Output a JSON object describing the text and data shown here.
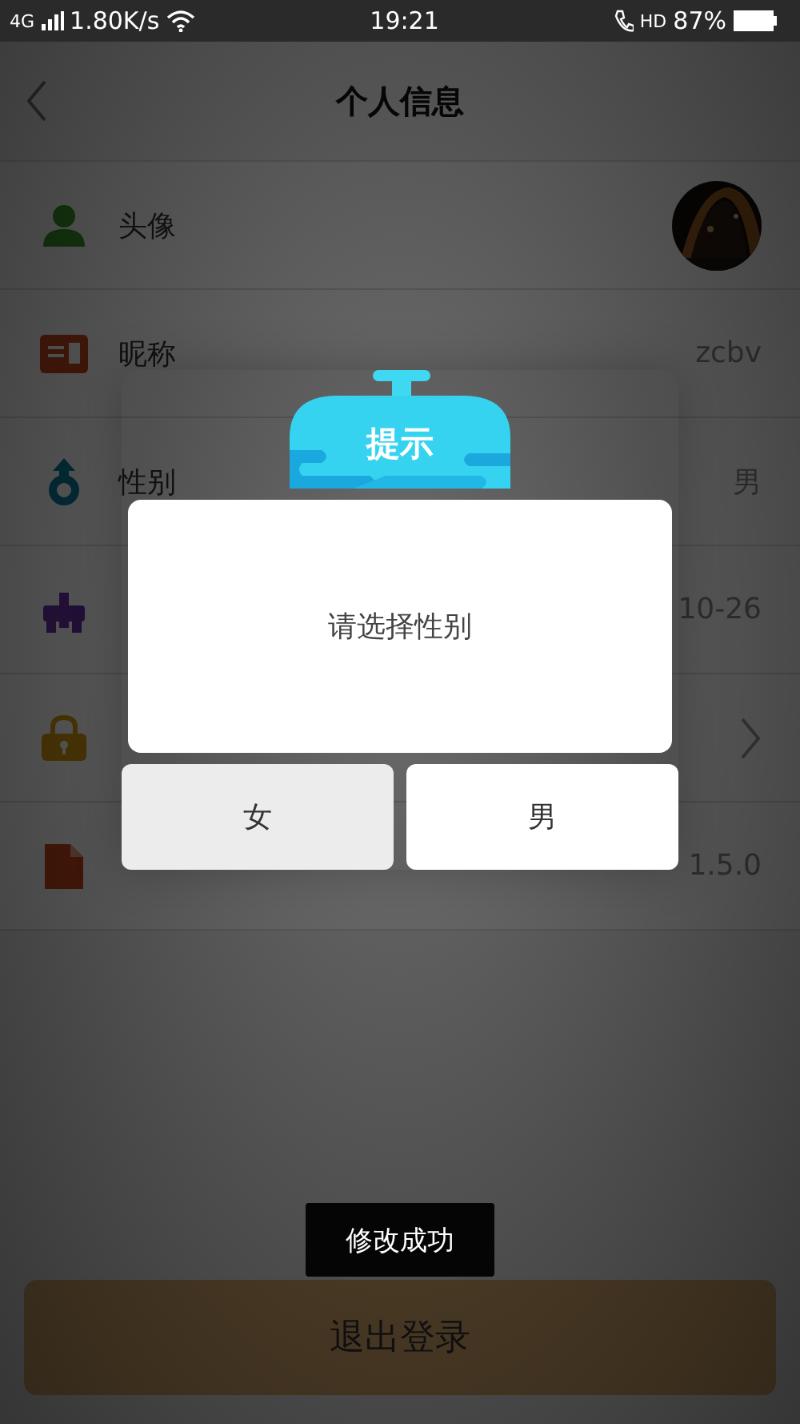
{
  "status_bar": {
    "network": "4G",
    "speed": "1.80K/s",
    "time": "19:21",
    "call": "HD",
    "battery": "87%"
  },
  "header": {
    "title": "个人信息"
  },
  "rows": [
    {
      "label": "头像"
    },
    {
      "label": "昵称",
      "value": "zcbv"
    },
    {
      "label": "性别",
      "value": "男"
    },
    {
      "value": "10-26"
    },
    {},
    {
      "value": "1.5.0"
    }
  ],
  "dialog": {
    "title": "提示",
    "message": "请选择性别",
    "buttons": [
      {
        "label": "女",
        "pressed": true
      },
      {
        "label": "男",
        "pressed": false
      }
    ]
  },
  "toast": "修改成功",
  "logout_button": "退出登录"
}
